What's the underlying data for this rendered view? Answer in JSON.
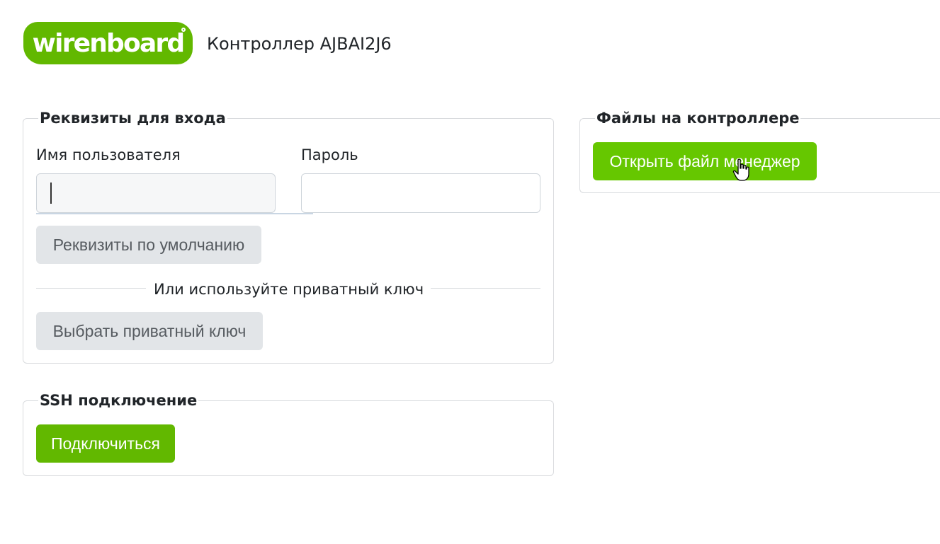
{
  "header": {
    "logo_text": "wirenboard",
    "title": "Контроллер AJBAI2J6"
  },
  "login": {
    "title": "Реквизиты для входа",
    "username_label": "Имя пользователя",
    "username_value": "",
    "password_label": "Пароль",
    "password_value": "",
    "default_button": "Реквизиты по умолчанию",
    "divider_text": "Или используйте приватный ключ",
    "key_button": "Выбрать приватный ключ"
  },
  "ssh": {
    "title": "SSH подключение",
    "connect_button": "Подключиться"
  },
  "files": {
    "title": "Файлы на контроллере",
    "open_button": "Открыть файл менеджер"
  },
  "colors": {
    "brand": "#62b800",
    "secondary_button": "#e2e5e8",
    "border": "#d9dbde"
  },
  "icons": {
    "cursor": "hand-pointer-icon"
  }
}
